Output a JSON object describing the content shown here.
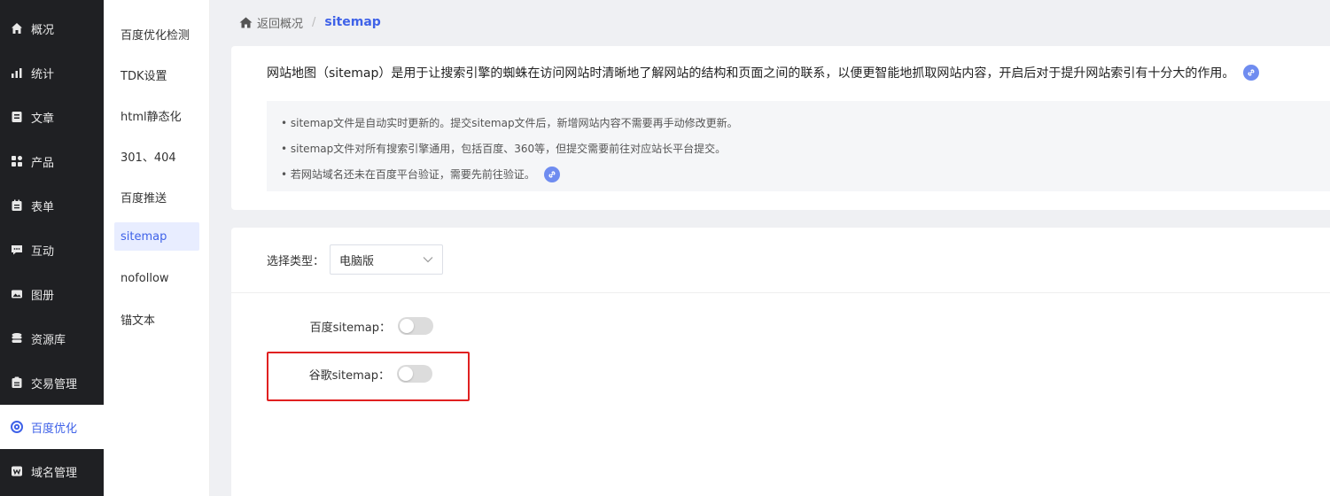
{
  "sidebar": {
    "items": [
      {
        "label": "概况",
        "icon": "home-icon"
      },
      {
        "label": "统计",
        "icon": "stats-icon"
      },
      {
        "label": "文章",
        "icon": "article-icon"
      },
      {
        "label": "产品",
        "icon": "product-icon"
      },
      {
        "label": "表单",
        "icon": "form-icon"
      },
      {
        "label": "互动",
        "icon": "chat-icon"
      },
      {
        "label": "图册",
        "icon": "album-icon"
      },
      {
        "label": "资源库",
        "icon": "database-icon"
      },
      {
        "label": "交易管理",
        "icon": "trade-icon"
      },
      {
        "label": "百度优化",
        "icon": "seo-icon",
        "active": true
      },
      {
        "label": "域名管理",
        "icon": "domain-icon"
      }
    ]
  },
  "submenu": {
    "items": [
      {
        "label": "百度优化检测"
      },
      {
        "label": "TDK设置"
      },
      {
        "label": "html静态化"
      },
      {
        "label": "301、404"
      },
      {
        "label": "百度推送"
      },
      {
        "label": "sitemap",
        "active": true
      },
      {
        "label": "nofollow"
      },
      {
        "label": "锚文本"
      }
    ]
  },
  "breadcrumb": {
    "back_label": "返回概况",
    "separator": "/",
    "current": "sitemap"
  },
  "info": {
    "intro": "网站地图（sitemap）是用于让搜索引擎的蜘蛛在访问网站时清晰地了解网站的结构和页面之间的联系，以便更智能地抓取网站内容，开启后对于提升网站索引有十分大的作用。",
    "tips": [
      "• sitemap文件是自动实时更新的。提交sitemap文件后，新增网站内容不需要再手动修改更新。",
      "• sitemap文件对所有搜索引擎通用，包括百度、360等，但提交需要前往对应站长平台提交。",
      "• 若网站域名还未在百度平台验证，需要先前往验证。"
    ]
  },
  "settings": {
    "type_label": "选择类型：",
    "type_value": "电脑版",
    "baidu_label": "百度sitemap：",
    "baidu_enabled": false,
    "google_label": "谷歌sitemap：",
    "google_enabled": false
  },
  "colors": {
    "accent": "#3f62e8",
    "sidebar_bg": "#1f2023",
    "highlight": "#e02020"
  }
}
